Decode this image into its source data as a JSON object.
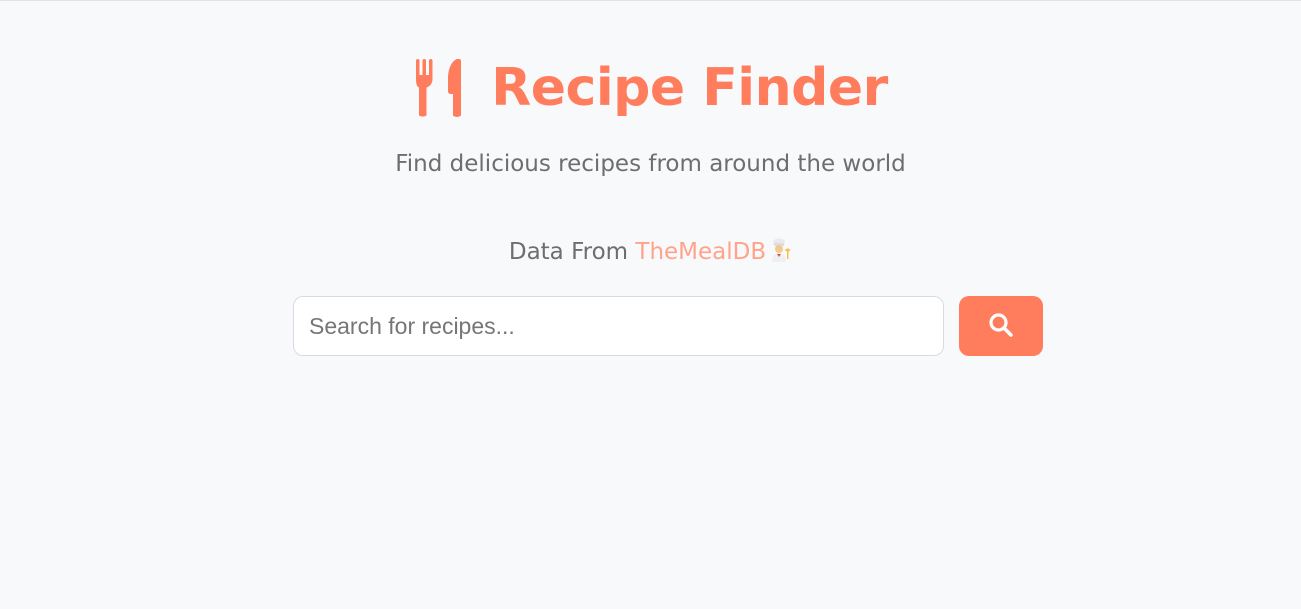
{
  "header": {
    "title": "Recipe Finder",
    "subtitle": "Find delicious recipes from around the world",
    "logo_icon": "utensils-icon"
  },
  "credit": {
    "prefix": "Data From ",
    "link_text": "TheMealDB",
    "emoji_icon": "chef-icon"
  },
  "search": {
    "placeholder": "Search for recipes...",
    "value": "",
    "button_icon": "search-icon"
  },
  "colors": {
    "accent": "#ff7d5c",
    "link": "#ffa38b",
    "background": "#f8f9fb",
    "text_muted": "#6e6e6e"
  }
}
